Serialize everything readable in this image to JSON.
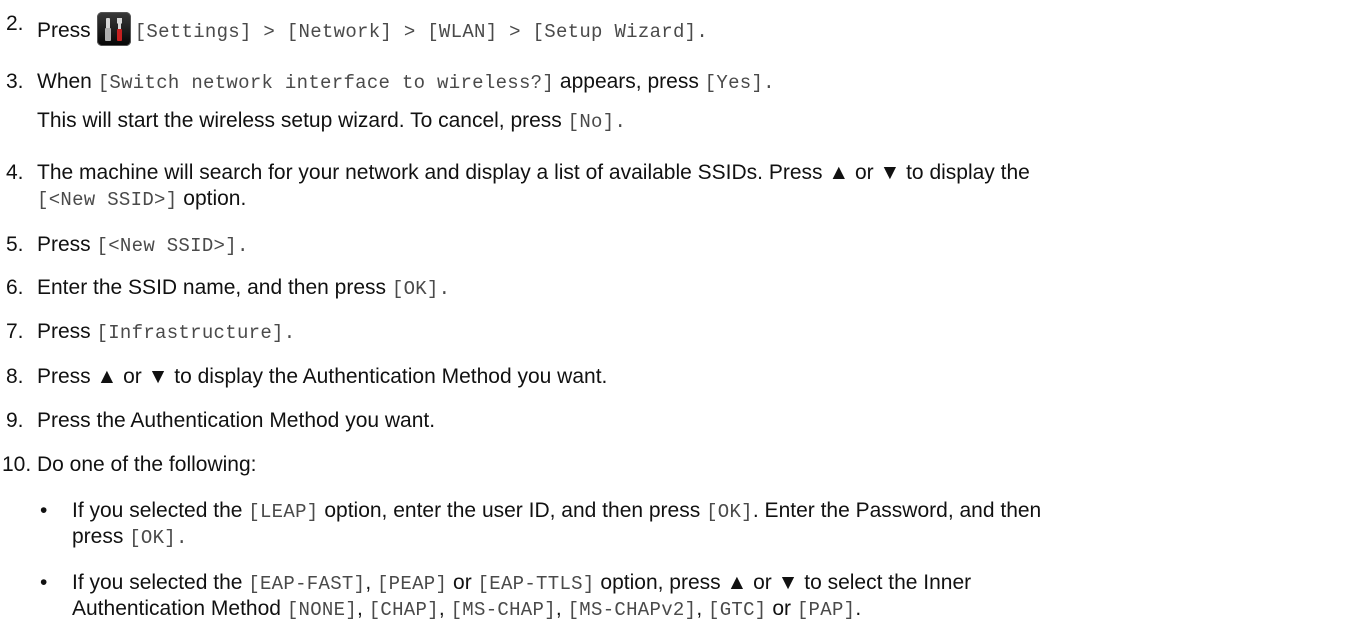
{
  "steps": [
    {
      "num": "2.",
      "parts": [
        "Press",
        "[Settings] > [Network] > [WLAN] > [Setup Wizard]."
      ]
    },
    {
      "num": "3.",
      "parts": [
        "When ",
        "[Switch network interface to wireless?]",
        " appears, press ",
        "[Yes]."
      ],
      "sub": [
        "This will start the wireless setup wizard. To cancel, press ",
        "[No]."
      ]
    },
    {
      "num": "4.",
      "parts": [
        "The machine will search for your network and display a list of available SSIDs. Press ▲ or ▼ to display the"
      ],
      "sub": [
        "[<New SSID>]",
        " option."
      ]
    },
    {
      "num": "5.",
      "parts": [
        "Press ",
        "[<New SSID>]."
      ]
    },
    {
      "num": "6.",
      "parts": [
        "Enter the SSID name, and then press ",
        "[OK]."
      ]
    },
    {
      "num": "7.",
      "parts": [
        "Press ",
        "[Infrastructure]."
      ]
    },
    {
      "num": "8.",
      "parts": [
        "Press ▲ or ▼ to display the Authentication Method you want."
      ]
    },
    {
      "num": "9.",
      "parts": [
        "Press the Authentication Method you want."
      ]
    },
    {
      "num": "10.",
      "parts": [
        "Do one of the following:"
      ]
    }
  ],
  "bullets": [
    {
      "parts": [
        "If you selected the ",
        "[LEAP]",
        " option, enter the user ID, and then press ",
        "[OK]",
        ". Enter the Password, and then"
      ],
      "cont": [
        "press ",
        "[OK]."
      ]
    },
    {
      "parts": [
        "If you selected the ",
        "[EAP-FAST]",
        ", ",
        "[PEAP]",
        " or ",
        "[EAP-TTLS]",
        " option, press ▲ or ▼ to select the Inner"
      ],
      "cont": [
        "Authentication Method ",
        "[NONE]",
        ", ",
        "[CHAP]",
        ", ",
        "[MS-CHAP]",
        ", ",
        "[MS-CHAPv2]",
        ", ",
        "[GTC]",
        " or ",
        "[PAP]",
        "."
      ]
    }
  ],
  "bullet_char": "•",
  "icons": {
    "settings": "settings-tools-icon"
  }
}
